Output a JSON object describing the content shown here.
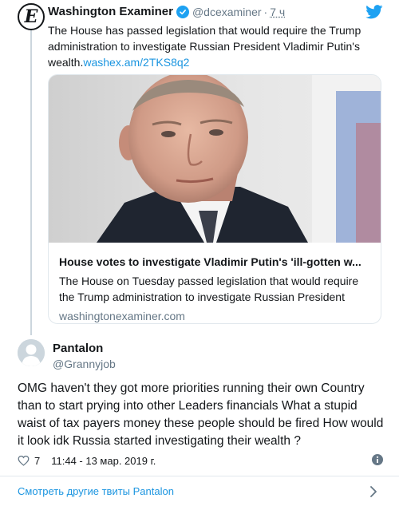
{
  "original_tweet": {
    "author_name": "Washington Examiner",
    "avatar_letter": "E",
    "handle": "@dcexaminer",
    "separator": "·",
    "time": "7 ч",
    "text": "The House has passed legislation that would require the Trump administration to investigate Russian President Vladimir Putin's wealth.",
    "link": "washex.am/2TKS8q2",
    "card": {
      "title": "House votes to investigate Vladimir Putin's 'ill-gotten w...",
      "description": "The House on Tuesday passed legislation that would require the Trump administration to investigate Russian President",
      "domain": "washingtonexaminer.com"
    }
  },
  "reply": {
    "author_name": "Pantalon",
    "handle": "@Grannyjob",
    "text": "OMG haven't they got more priorities running their own Country than to start prying into other Leaders financials What a stupid waist of tax payers money these people should be fired How would it look idk Russia started investigating their wealth ?",
    "likes": "7",
    "timestamp": "11:44 - 13 мар. 2019 г."
  },
  "footer": {
    "more_tweets_label": "Смотреть другие твиты Pantalon"
  },
  "icons": {
    "brand": "twitter-bird-icon",
    "verified": "verified-badge-icon",
    "like": "heart-icon",
    "info": "info-icon",
    "chevron": "chevron-right-icon"
  },
  "colors": {
    "twitter_blue": "#1da1f2",
    "link_blue": "#1b95e0",
    "text": "#14171a",
    "secondary": "#657786",
    "border": "#e1e8ed"
  }
}
